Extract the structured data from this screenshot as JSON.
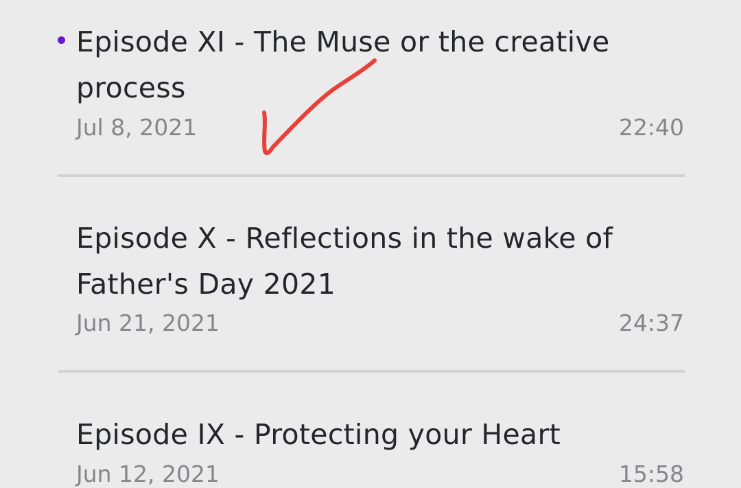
{
  "episodes": [
    {
      "title": "Episode XI - The Muse or the creative process",
      "date": "Jul 8, 2021",
      "duration": "22:40",
      "unplayed": true
    },
    {
      "title": "Episode X - Reflections in the wake of Father's Day 2021",
      "date": "Jun 21, 2021",
      "duration": "24:37",
      "unplayed": false
    },
    {
      "title": "Episode IX - Protecting your Heart",
      "date": "Jun 12, 2021",
      "duration": "15:58",
      "unplayed": false
    }
  ],
  "colors": {
    "background": "#ebebeb",
    "title_text": "#25262b",
    "meta_text": "#86868a",
    "unplayed_dot": "#6a1bd1",
    "divider": "#d2d2d2",
    "annotation_check": "#e8413a"
  },
  "annotation": {
    "icon": "handwritten-checkmark-icon"
  }
}
